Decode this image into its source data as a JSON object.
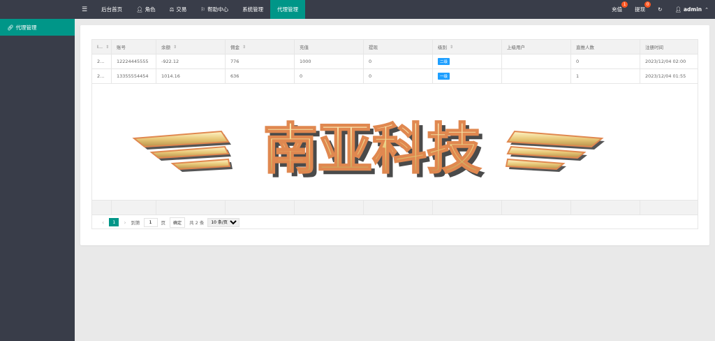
{
  "topbar": {
    "menu_icon": "menu-icon",
    "nav": [
      {
        "label": "后台首页",
        "icon": ""
      },
      {
        "label": "角色",
        "icon": "user-icon"
      },
      {
        "label": "交易",
        "icon": "scale-icon"
      },
      {
        "label": "帮助中心",
        "icon": "flag-icon"
      },
      {
        "label": "系统管理",
        "icon": ""
      },
      {
        "label": "代理管理",
        "icon": "",
        "active": true
      }
    ],
    "recharge_label": "充值",
    "recharge_badge": "1",
    "withdraw_label": "提现",
    "withdraw_badge": "0",
    "user_label": "admin"
  },
  "sidebar": {
    "items": [
      {
        "label": "代理管理",
        "icon": "link-icon"
      }
    ]
  },
  "table": {
    "headers": [
      "I...",
      "账号",
      "余额",
      "佣金",
      "充值",
      "提现",
      "级别",
      "上级用户",
      "直推人数",
      "注册时间"
    ],
    "rows": [
      [
        "2...",
        "12224445555",
        "-922.12",
        "776",
        "1000",
        "0",
        "二级",
        "",
        "0",
        "2023/12/04 02:00"
      ],
      [
        "2...",
        "13355554454",
        "1014.16",
        "636",
        "0",
        "0",
        "一级",
        "",
        "1",
        "2023/12/04 01:55"
      ]
    ]
  },
  "logo_text": "南亚科技",
  "pager": {
    "current": "1",
    "goto_label": "到第",
    "page_value": "1",
    "page_unit": "页",
    "confirm_label": "确定",
    "total_label": "共 2 条",
    "page_size": "10 条/页"
  },
  "colors": {
    "topbar": "#393d49",
    "accent": "#009688",
    "badge": "#ff5722",
    "level_tag": "#1e9fff"
  }
}
